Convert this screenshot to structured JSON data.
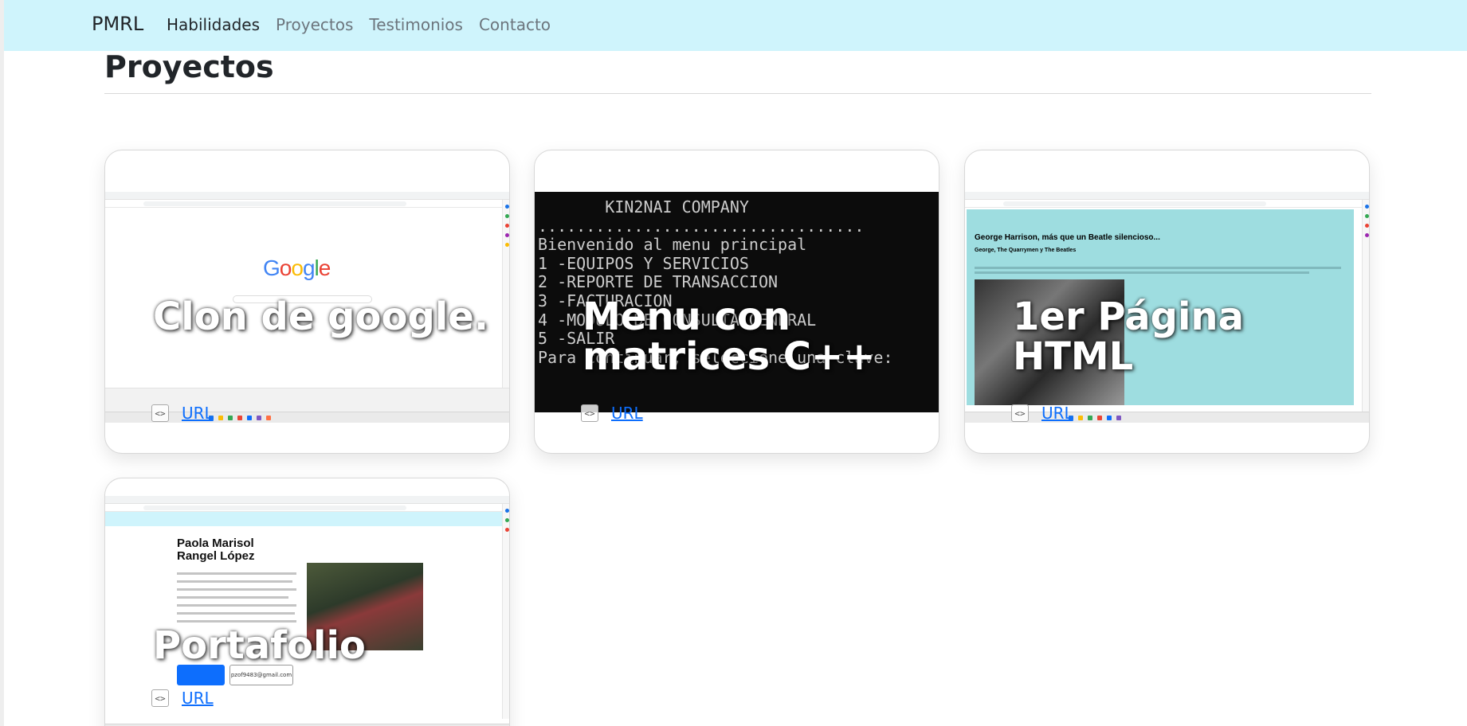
{
  "navbar": {
    "brand": "PMRL",
    "links": [
      {
        "label": "Habilidades",
        "active": true
      },
      {
        "label": "Proyectos",
        "active": false
      },
      {
        "label": "Testimonios",
        "active": false
      },
      {
        "label": "Contacto",
        "active": false
      }
    ],
    "background": "#cff4fc"
  },
  "section": {
    "title": "Proyectos"
  },
  "projects": [
    {
      "title": "Clon de google.",
      "link_label": "URL"
    },
    {
      "title_line1": "Menu con",
      "title_line2": "matrices C++",
      "link_label": "URL"
    },
    {
      "title_line1": "1er Página",
      "title_line2": "HTML",
      "link_label": "URL"
    },
    {
      "title": "Portafolio",
      "link_label": "URL"
    }
  ],
  "screenshots": {
    "google": {
      "logo": "Google"
    },
    "console": {
      "lines": [
        "       KIN2NAI COMPANY",
        "..................................",
        "Bienvenido al menu principal",
        "",
        "1 -EQUIPOS Y SERVICIOS",
        "2 -REPORTE DE TRANSACCION",
        "3 -FACTURACION",
        "4 -MODULO DE CONSULTA GENERAL",
        "5 -SALIR",
        "Para continuar, seleccione una clave:"
      ]
    },
    "beatles": {
      "heading": "George Harrison, más que un Beatle silencioso...",
      "subheading": "George, The Quarrymen y The Beatles"
    },
    "portfolio": {
      "name_line1": "Paola Marisol",
      "name_line2": "Rangel López",
      "email": "pzof9483@gmail.com"
    }
  },
  "colors": {
    "link": "#0d6efd",
    "console_bg": "#0c0c0c",
    "beatles_bg": "#9edde0"
  }
}
